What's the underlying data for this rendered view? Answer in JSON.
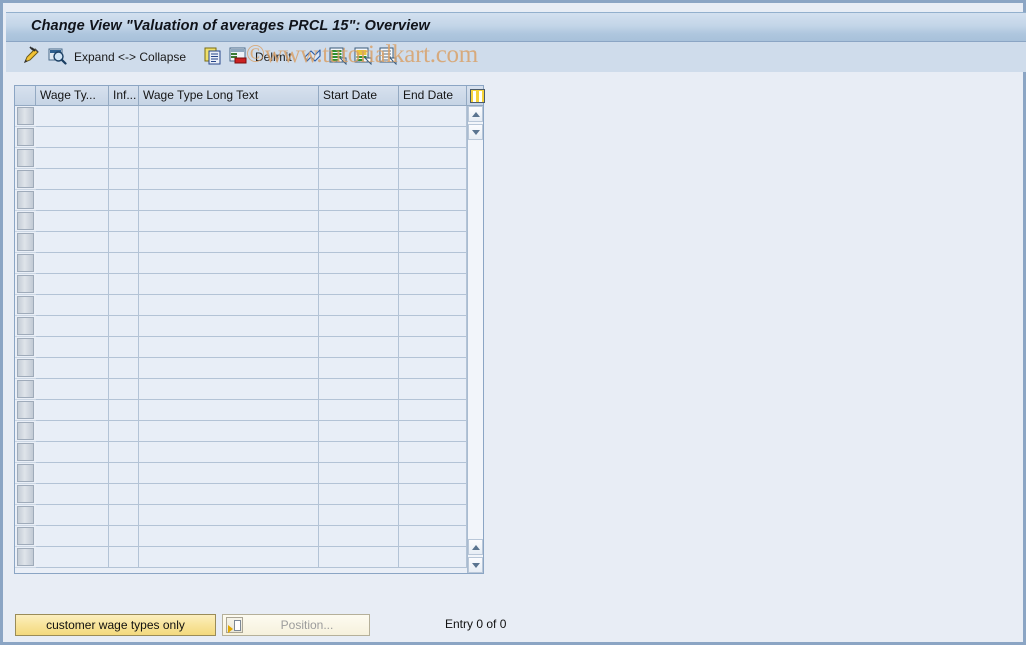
{
  "window": {
    "title": "Change View \"Valuation of averages PRCL 15\": Overview"
  },
  "watermark": {
    "text": "©www.tutorialkart.com"
  },
  "toolbar": {
    "items": [
      {
        "name": "display-change-icon",
        "label": "",
        "icon": "pencil-icon"
      },
      {
        "name": "details-icon",
        "label": "",
        "icon": "magnifier-icon"
      },
      {
        "name": "expand-collapse-button",
        "label": "Expand <-> Collapse",
        "icon": ""
      },
      {
        "name": "copy-as-icon",
        "label": "",
        "icon": "copy-icon"
      },
      {
        "name": "delete-icon",
        "label": "",
        "icon": "delete-row-icon"
      },
      {
        "name": "delimit-button",
        "label": "Delimit",
        "icon": ""
      },
      {
        "name": "undo-icon",
        "label": "",
        "icon": "undo-arrow-icon"
      },
      {
        "name": "select-all-icon",
        "label": "",
        "icon": "list-green-icon"
      },
      {
        "name": "select-block-icon",
        "label": "",
        "icon": "list-yellow-icon"
      },
      {
        "name": "deselect-all-icon",
        "label": "",
        "icon": "list-plain-icon"
      }
    ],
    "expand_collapse_label": "Expand <-> Collapse",
    "delimit_label": "Delimit"
  },
  "table": {
    "columns": [
      {
        "key": "selector",
        "label": ""
      },
      {
        "key": "wage_type",
        "label": "Wage Ty..."
      },
      {
        "key": "info",
        "label": "Inf..."
      },
      {
        "key": "long_text",
        "label": "Wage Type Long Text"
      },
      {
        "key": "start_date",
        "label": "Start Date"
      },
      {
        "key": "end_date",
        "label": "End Date"
      }
    ],
    "rows": [],
    "row_count": 22,
    "config_icon": "table-settings-icon"
  },
  "footer": {
    "customer_wage_types_label": "customer wage types only",
    "position_label": "Position...",
    "entry_count_label": "Entry 0 of 0"
  },
  "colors": {
    "background": "#e8edf5",
    "title_bar": "#aec6de",
    "toolbar": "#cfdceb",
    "accent_yellow": "#f3d97e",
    "watermark": "#d9a066",
    "border": "#8ba5c4"
  }
}
